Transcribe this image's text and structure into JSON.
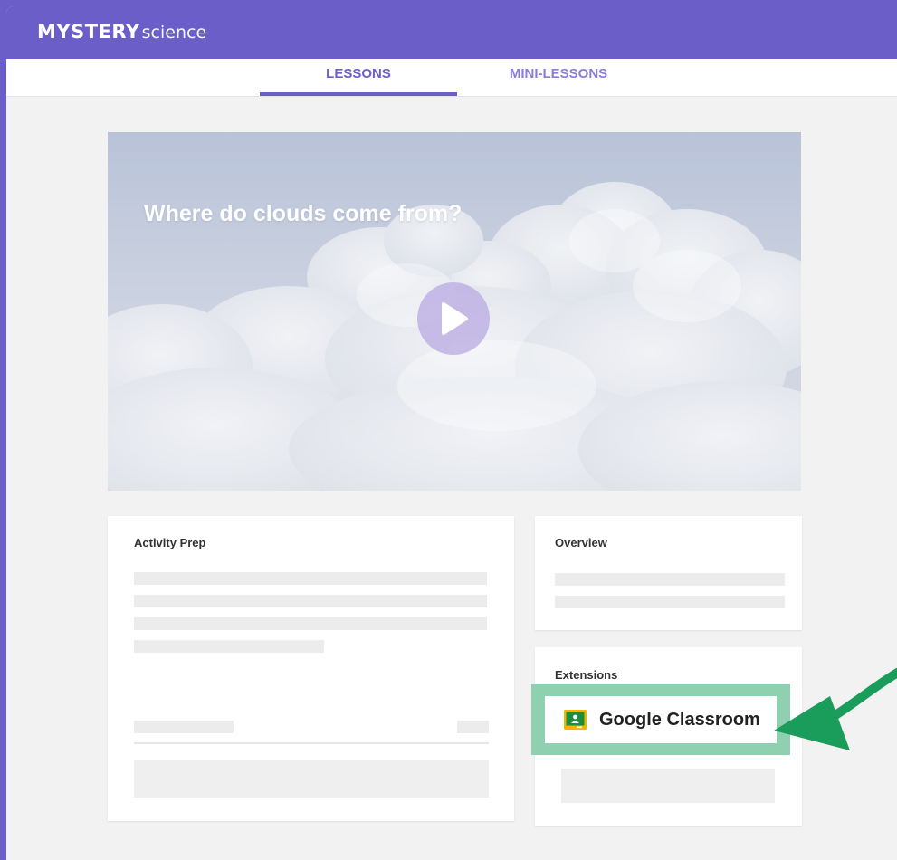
{
  "brand": {
    "logo_bold": "MYSTERY",
    "logo_light": "science",
    "color": "#6b5ec9"
  },
  "tabs": [
    {
      "label": "LESSONS",
      "active": true
    },
    {
      "label": "MINI-LESSONS",
      "active": false
    }
  ],
  "video": {
    "title": "Where do clouds come from?",
    "play_icon": "play-icon"
  },
  "activity_prep": {
    "title": "Activity Prep"
  },
  "overview": {
    "title": "Overview"
  },
  "extensions": {
    "title": "Extensions",
    "google_classroom": {
      "label": "Google Classroom",
      "icon": "google-classroom-icon",
      "highlight_color": "#8fd0b0"
    }
  },
  "annotation": {
    "arrow_color": "#1a9c5b",
    "arrow_icon": "arrow-icon"
  }
}
